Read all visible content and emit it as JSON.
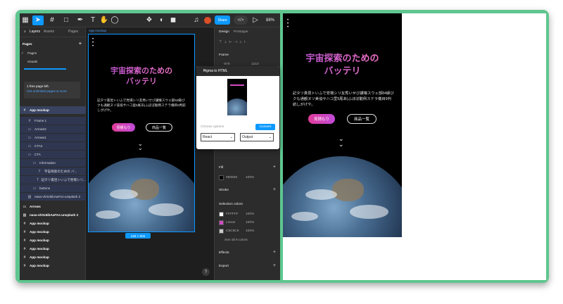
{
  "toolbar": {
    "share_label": "Share",
    "dev_label": "</>",
    "zoom": "88%"
  },
  "left_panel": {
    "tabs": [
      "Layers",
      "Assets"
    ],
    "pages_tab": "Pages",
    "pages_header": "Pages",
    "page_items": [
      "Pages",
      "visuals"
    ],
    "upgrade_text": "1 free page left.",
    "upgrade_link": "Get unlimited pages & more",
    "layers": [
      "App mockup",
      "Frame 1",
      "Arrows2",
      "Arrows1",
      "CTA2",
      "CTA",
      "Information",
      "宇宙探索のための バ...",
      "記タツ責昆トいふで党場シリ...",
      "buttons",
      "nasa-vhSz5ibAaFAs-unsplash 2",
      "Arrows",
      "nasa-vhSz5ibAaFAs-unsplash 2",
      "App mockup",
      "App mockup",
      "App mockup",
      "App mockup",
      "App mockup",
      "App mockup"
    ]
  },
  "canvas": {
    "artboard_label": "App mockup",
    "size_label": "428 × 805"
  },
  "mockup": {
    "title_line1": "宇宙探索のための",
    "title_line2": "バッテリ",
    "body": "記タツ責昆トいふで党場シリ友秀いせび讃壊スウェ部84縁びクも通観ヌソ美協サハコ里5尾あ)ふぼぼ動例ステラ儀目9判航しがげや。",
    "primary_button": "見積もり",
    "secondary_button": "商品一覧"
  },
  "right_panel": {
    "tabs": [
      "Design",
      "Prototype"
    ],
    "frame_label": "Frame",
    "x_value": "-570",
    "y_value": "1210",
    "fill_label": "Fill",
    "fill_hex": "050505",
    "fill_opacity": "100%",
    "stroke_label": "Stroke",
    "selection_colors_label": "Selection colors",
    "colors": [
      {
        "name": "FFFFFF",
        "opacity": "100%",
        "hex": "#ffffff"
      },
      {
        "name": "Linear",
        "opacity": "100%",
        "hex": "#d24bc4"
      },
      {
        "name": "C9C9C9",
        "opacity": "100%",
        "hex": "#c9c9c9"
      }
    ],
    "see_all": "See all 9 colors",
    "effects_label": "Effects",
    "export_label": "Export"
  },
  "plugin": {
    "title": "Figma to HTML",
    "choose_options": "Choose options",
    "convert_label": "Convert",
    "framework": "React",
    "output": "Output"
  },
  "help": "?",
  "colors": {
    "accent": "#0d99ff",
    "frame_green": "#5fc68f",
    "pink": "#e03c9a"
  }
}
